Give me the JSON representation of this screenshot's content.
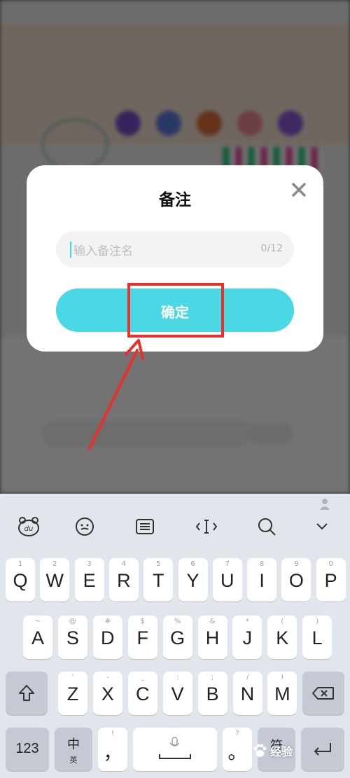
{
  "dialog": {
    "title": "备注",
    "input_placeholder": "输入备注名",
    "char_counter": "0/12",
    "confirm_label": "确定"
  },
  "keyboard": {
    "toolbar": [
      "du-logo-icon",
      "emoji-icon",
      "keyboard-layout-icon",
      "cursor-icon",
      "search-icon",
      "collapse-icon"
    ],
    "rows": [
      [
        {
          "k": "Q",
          "h": "1"
        },
        {
          "k": "W",
          "h": "2"
        },
        {
          "k": "E",
          "h": "3"
        },
        {
          "k": "R",
          "h": "4"
        },
        {
          "k": "T",
          "h": "5"
        },
        {
          "k": "Y",
          "h": "6"
        },
        {
          "k": "U",
          "h": "7"
        },
        {
          "k": "I",
          "h": "8"
        },
        {
          "k": "O",
          "h": "9"
        },
        {
          "k": "P",
          "h": "0"
        }
      ],
      [
        {
          "k": "A",
          "h": "~"
        },
        {
          "k": "S",
          "h": "@"
        },
        {
          "k": "D",
          "h": "#"
        },
        {
          "k": "F",
          "h": "$"
        },
        {
          "k": "G",
          "h": "%"
        },
        {
          "k": "H",
          "h": "&"
        },
        {
          "k": "J",
          "h": "*"
        },
        {
          "k": "K",
          "h": "("
        },
        {
          "k": "L",
          "h": ")"
        }
      ],
      [
        {
          "k": "Z",
          "h": "'"
        },
        {
          "k": "X",
          "h": "-"
        },
        {
          "k": "C",
          "h": "_"
        },
        {
          "k": "V",
          "h": ":"
        },
        {
          "k": "B",
          "h": ";"
        },
        {
          "k": "N",
          "h": "/"
        },
        {
          "k": "M",
          "h": "!"
        }
      ]
    ],
    "bottom": {
      "numbers": "123",
      "lang_main": "中",
      "lang_sub": "英",
      "comma": "，",
      "comma_hint": "!",
      "period": "。",
      "period_hint": "?",
      "symbol_main": "符"
    }
  },
  "watermark": {
    "text": "经验"
  },
  "colors": {
    "accent": "#49d8e4",
    "annotation": "#e8312b"
  }
}
